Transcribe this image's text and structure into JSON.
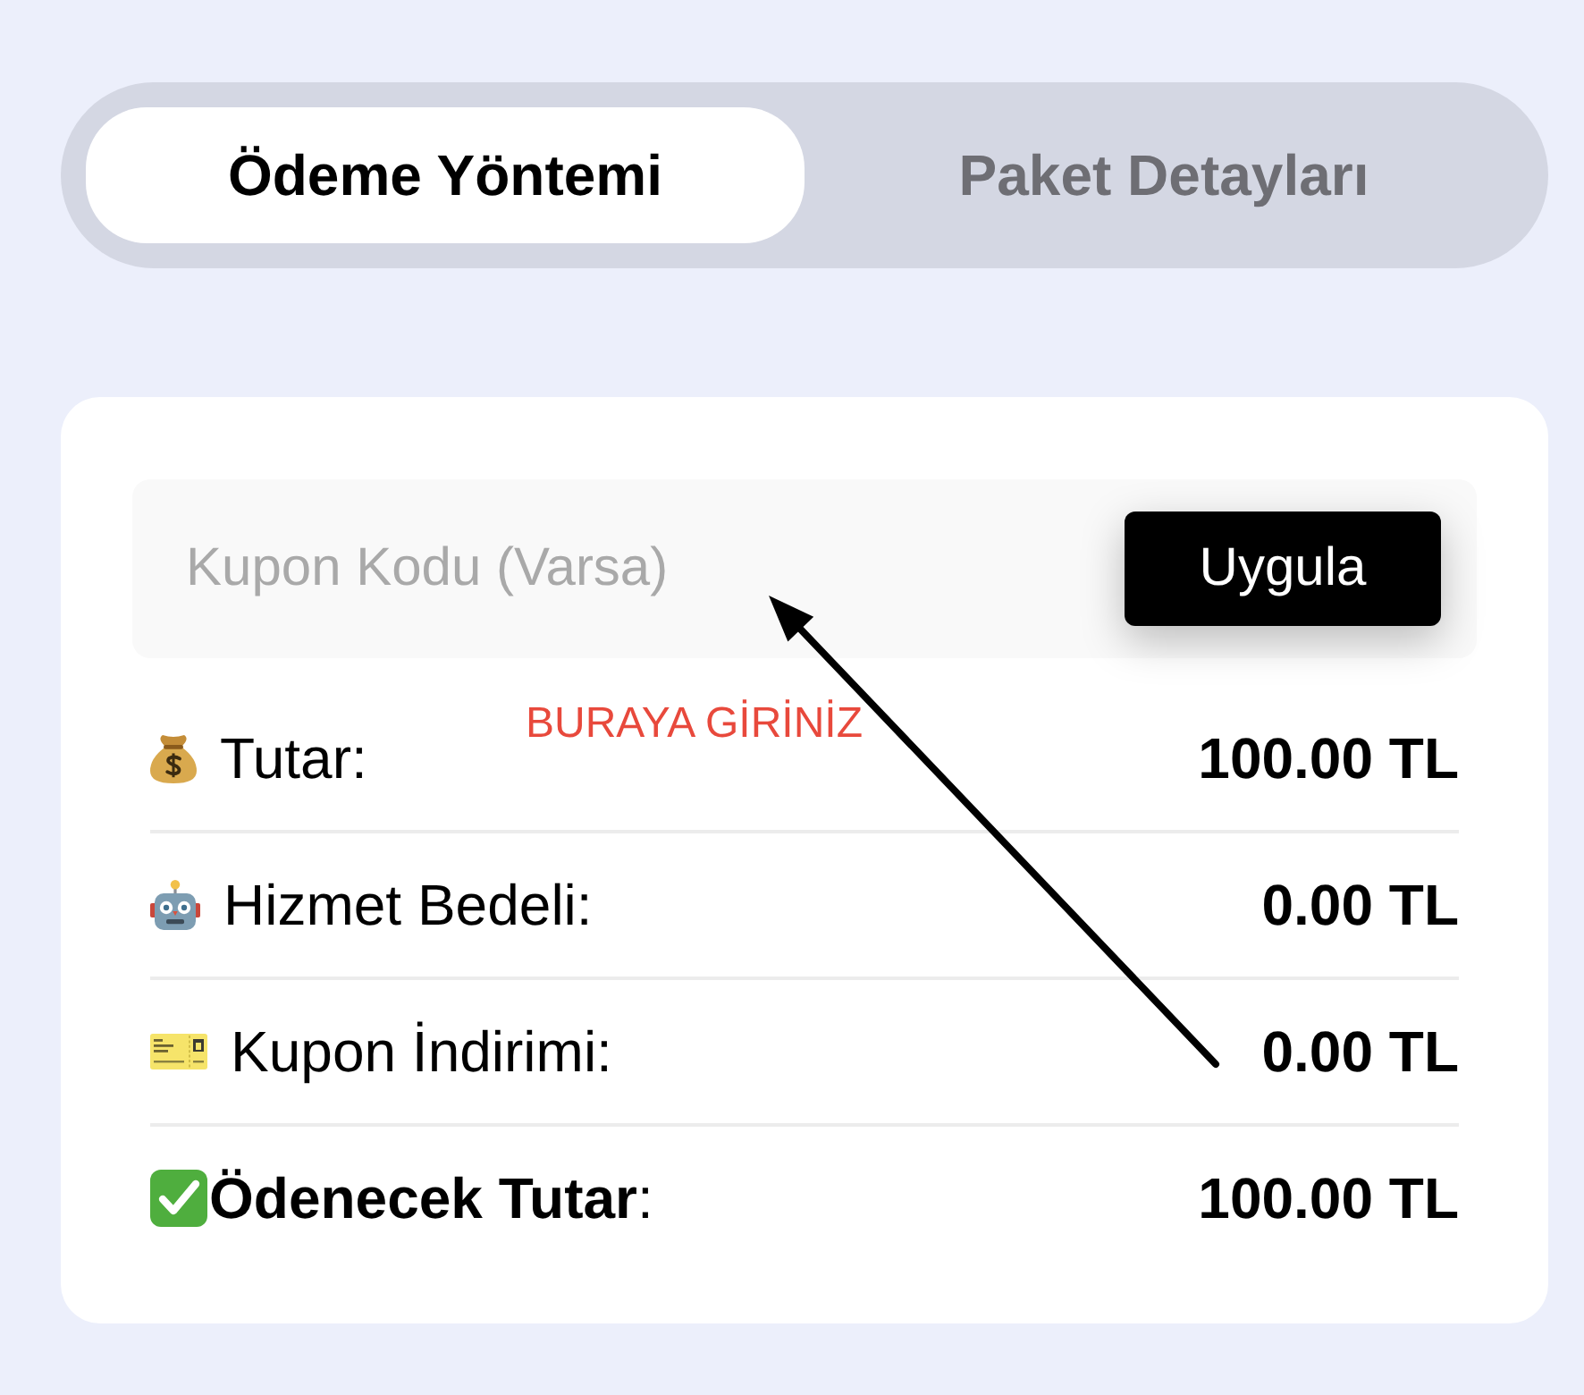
{
  "tabs": [
    {
      "label": "Ödeme Yöntemi",
      "selected": true
    },
    {
      "label": "Paket Detayları",
      "selected": false
    }
  ],
  "coupon": {
    "placeholder": "Kupon Kodu (Varsa)",
    "button": "Uygula"
  },
  "annotation": {
    "text": "BURAYA GİRİNİZ"
  },
  "summary": [
    {
      "kind": "item",
      "label": "Tutar:",
      "value": "100.00 TL"
    },
    {
      "kind": "item",
      "label": "Hizmet Bedeli:",
      "value": "0.00 TL"
    },
    {
      "kind": "item",
      "label": "Kupon İndirimi:",
      "value": "0.00 TL"
    },
    {
      "kind": "total",
      "label": "**Ödenecek Tutar**:",
      "value": "100.00 TL"
    }
  ]
}
